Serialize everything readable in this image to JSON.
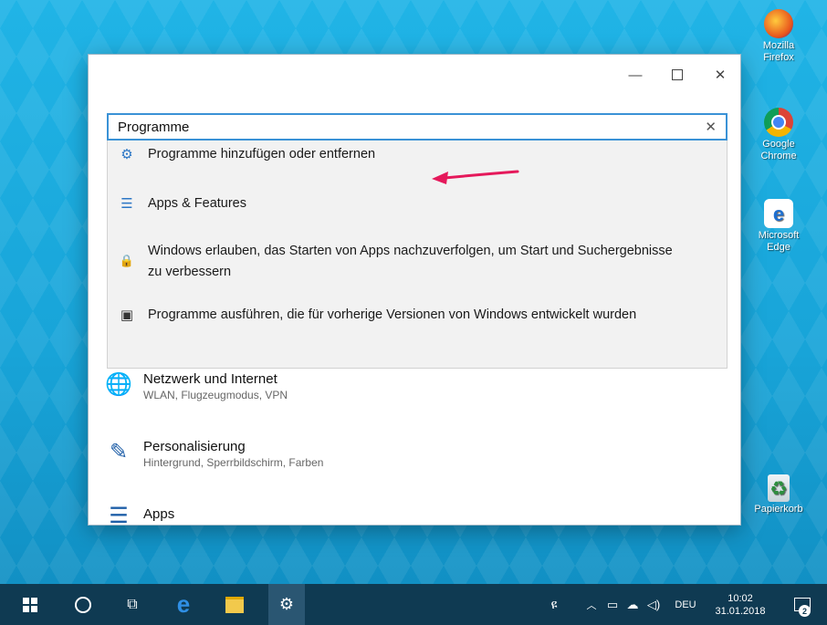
{
  "desktop": {
    "icons": [
      {
        "label": "Mozilla Firefox",
        "icon": "firefox-icon"
      },
      {
        "label": "Google Chrome",
        "icon": "chrome-icon"
      },
      {
        "label": "Microsoft Edge",
        "icon": "edge-icon"
      },
      {
        "label": "Papierkorb",
        "icon": "recycle-bin-icon"
      }
    ]
  },
  "window": {
    "controls": {
      "minimize": "—",
      "maximize": "",
      "close": "✕"
    },
    "search": {
      "value": "Programme",
      "clear": "✕"
    },
    "suggestions": [
      {
        "icon": "gear-icon",
        "glyph": "⚙",
        "text": "Programme hinzufügen oder entfernen"
      },
      {
        "icon": "list-icon",
        "glyph": "☰",
        "text": "Apps & Features"
      },
      {
        "icon": "lock-icon",
        "glyph": "🔒",
        "text": "Windows erlauben, das Starten von Apps nachzuverfolgen, um Start und Suchergebnisse zu verbessern"
      },
      {
        "icon": "compatibility-icon",
        "glyph": "▣",
        "text": "Programme ausführen, die für vorherige Versionen von Windows entwickelt wurden"
      }
    ],
    "settings": [
      {
        "icon": "globe-icon",
        "glyph": "🌐",
        "title": "Netzwerk und Internet",
        "subtitle": "WLAN, Flugzeugmodus, VPN"
      },
      {
        "icon": "personalize-icon",
        "glyph": "✎",
        "title": "Personalisierung",
        "subtitle": "Hintergrund, Sperrbildschirm, Farben"
      },
      {
        "icon": "apps-icon",
        "glyph": "☰",
        "title": "Apps",
        "subtitle": ""
      }
    ]
  },
  "taskbar": {
    "language": "DEU",
    "time": "10:02",
    "date": "31.01.2018",
    "notifications": "2"
  },
  "colors": {
    "accent": "#3a92d6",
    "arrow": "#e5195b",
    "taskbar": "#0f3a52"
  }
}
